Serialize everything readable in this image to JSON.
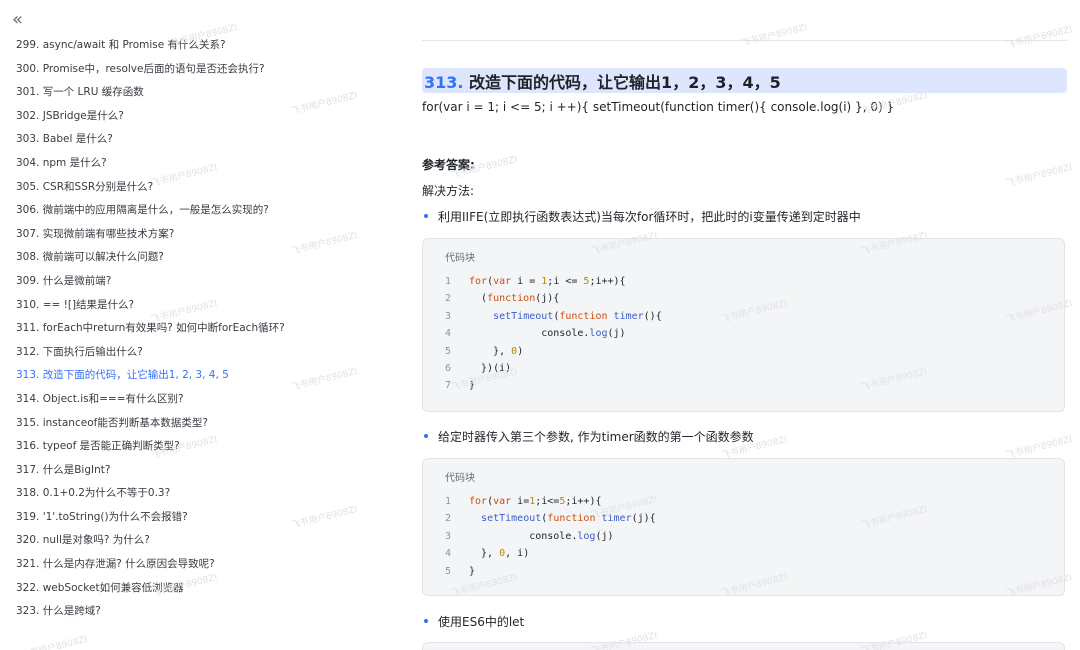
{
  "sidebar": {
    "collapse_glyph": "«",
    "items": [
      {
        "label": "299. async/await 和 Promise 有什么关系?"
      },
      {
        "label": "300. Promise中，resolve后面的语句是否还会执行?"
      },
      {
        "label": "301. 写一个 LRU 缓存函数"
      },
      {
        "label": "302. JSBridge是什么?"
      },
      {
        "label": "303. Babel 是什么?"
      },
      {
        "label": "304. npm 是什么?"
      },
      {
        "label": "305. CSR和SSR分别是什么?"
      },
      {
        "label": "306. 微前端中的应用隔离是什么，一般是怎么实现的?"
      },
      {
        "label": "307. 实现微前端有哪些技术方案?"
      },
      {
        "label": "308. 微前端可以解决什么问题?"
      },
      {
        "label": "309. 什么是微前端?"
      },
      {
        "label": "310. == ![]结果是什么?"
      },
      {
        "label": "311. forEach中return有效果吗? 如何中断forEach循环?"
      },
      {
        "label": "312. 下面执行后输出什么?"
      },
      {
        "label": "313. 改造下面的代码，让它输出1, 2, 3, 4, 5",
        "active": true
      },
      {
        "label": "314. Object.is和===有什么区别?"
      },
      {
        "label": "315. instanceof能否判断基本数据类型?"
      },
      {
        "label": "316. typeof 是否能正确判断类型?"
      },
      {
        "label": "317. 什么是BigInt?"
      },
      {
        "label": "318. 0.1+0.2为什么不等于0.3?"
      },
      {
        "label": "319. '1'.toString()为什么不会报错?"
      },
      {
        "label": "320. null是对象吗? 为什么?"
      },
      {
        "label": "321. 什么是内存泄漏? 什么原因会导致呢?"
      },
      {
        "label": "322. webSocket如何兼容低浏览器"
      },
      {
        "label": "323. 什么是跨域?"
      }
    ]
  },
  "article": {
    "title_num": "313.",
    "title_text": " 改造下面的代码，让它输出1，2，3，4，5",
    "question_code": "for(var i = 1; i <= 5; i ++){ setTimeout(function timer(){ console.log(i) }, 0) }",
    "answer_heading": "参考答案:",
    "method_label": "解决方法:",
    "bullet1": "利用IIFE(立即执行函数表达式)当每次for循环时，把此时的i变量传递到定时器中",
    "bullet2": "给定时器传入第三个参数, 作为timer函数的第一个函数参数",
    "bullet3": "使用ES6中的let",
    "code_block_label": "代码块",
    "code1": [
      {
        "n": "1",
        "t": "for(var i = 1;i <= 5;i++){"
      },
      {
        "n": "2",
        "t": "  (function(j){"
      },
      {
        "n": "3",
        "t": "    setTimeout(function timer(){"
      },
      {
        "n": "4",
        "t": "            console.log(j)"
      },
      {
        "n": "5",
        "t": "    }, 0)"
      },
      {
        "n": "6",
        "t": "  })(i)"
      },
      {
        "n": "7",
        "t": "}"
      }
    ],
    "code2": [
      {
        "n": "1",
        "t": "for(var i=1;i<=5;i++){"
      },
      {
        "n": "2",
        "t": "  setTimeout(function timer(j){"
      },
      {
        "n": "3",
        "t": "          console.log(j)"
      },
      {
        "n": "4",
        "t": "  }, 0, i)"
      },
      {
        "n": "5",
        "t": "}"
      }
    ]
  },
  "watermark": "飞书用户8908ZI",
  "colors": {
    "accent": "#3370ff",
    "title_bg": "#dde6fc",
    "code_bg": "#f4f5f6"
  }
}
